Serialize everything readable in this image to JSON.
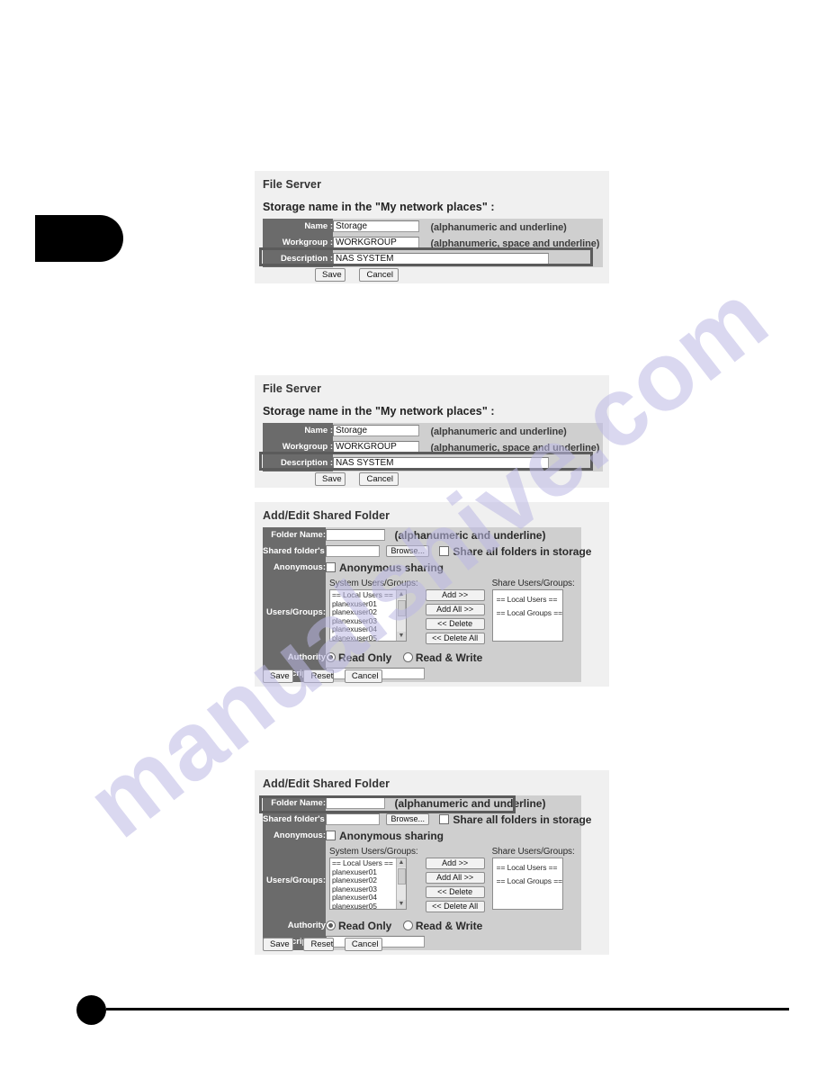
{
  "watermark": {
    "text": "manualshive.com"
  },
  "panel1": {
    "title": "File Server",
    "subtitle": "Storage name in the \"My network places\"  :",
    "rows": [
      {
        "label": "Name  :",
        "value": "Storage",
        "hint": "(alphanumeric and underline)"
      },
      {
        "label": "Workgroup  :",
        "value": "WORKGROUP",
        "hint": "(alphanumeric, space and underline)"
      },
      {
        "label": "Description  :",
        "value": "NAS SYSTEM",
        "hint": ""
      }
    ],
    "buttons": {
      "save": "Save",
      "cancel": "Cancel"
    }
  },
  "panel2": {
    "title": "File Server",
    "subtitle": "Storage name in the \"My network places\"  :",
    "rows": [
      {
        "label": "Name  :",
        "value": "Storage",
        "hint": "(alphanumeric and underline)"
      },
      {
        "label": "Workgroup  :",
        "value": "WORKGROUP",
        "hint": "(alphanumeric, space and underline)"
      },
      {
        "label": "Description  :",
        "value": "NAS SYSTEM",
        "hint": ""
      }
    ],
    "buttons": {
      "save": "Save",
      "cancel": "Cancel"
    }
  },
  "shared_folder": {
    "title": "Add/Edit Shared Folder",
    "folder_name_label": "Folder Name:",
    "folder_name_value": "",
    "folder_name_hint": "(alphanumeric and underline)",
    "path_label": "Shared folder's Path:",
    "path_value": "",
    "browse_label": "Browse...",
    "share_all_label": "Share all folders in storage",
    "anonymous_label": "Anonymous:",
    "anonymous_check_label": "Anonymous sharing",
    "users_groups_label": "Users/Groups:",
    "system_list_label": "System Users/Groups:",
    "share_list_label": "Share Users/Groups:",
    "system_list": [
      "== Local Users ==",
      "planexuser01",
      "planexuser02",
      "planexuser03",
      "planexuser04",
      "planexuser05"
    ],
    "share_list": [
      "== Local Users ==",
      "== Local Groups =="
    ],
    "transfer_buttons": {
      "add": "Add >>",
      "add_all": "Add All >>",
      "delete": "<< Delete",
      "delete_all": "<< Delete All"
    },
    "authority_label": "Authority",
    "authority_options": [
      {
        "label": "Read Only",
        "selected": true
      },
      {
        "label": "Read & Write",
        "selected": false
      }
    ],
    "description_label": "Description:",
    "description_value": "",
    "buttons": {
      "save": "Save",
      "reset": "Reset",
      "cancel": "Cancel"
    }
  }
}
